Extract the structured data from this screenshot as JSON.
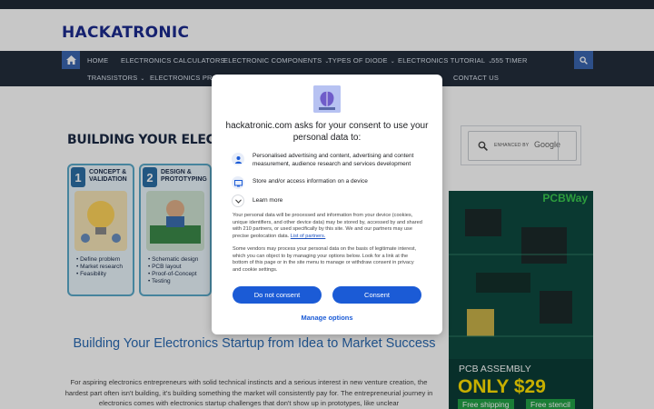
{
  "site": {
    "brand": "HACKATRONIC"
  },
  "nav": {
    "row1": [
      {
        "label": "HOME",
        "dropdown": false
      },
      {
        "label": "ELECTRONICS CALCULATORS",
        "dropdown": false
      },
      {
        "label": "ELECTRONIC COMPONENTS",
        "dropdown": true
      },
      {
        "label": "TYPES OF DIODE",
        "dropdown": true
      },
      {
        "label": "ELECTRONICS TUTORIAL",
        "dropdown": true
      },
      {
        "label": "555 TIMER",
        "dropdown": false
      }
    ],
    "row2": [
      {
        "label": "TRANSISTORS",
        "dropdown": true
      },
      {
        "label": "ELECTRONICS PROJ",
        "dropdown": false
      },
      {
        "label": "CONTACT US",
        "dropdown": false
      }
    ],
    "chevron": "⌄"
  },
  "hero": {
    "title": "BUILDING YOUR ELECTRONICS",
    "steps": [
      {
        "num": "1",
        "head": [
          "CONCEPT &",
          "VALIDATION"
        ],
        "items": [
          "• Define problem",
          "• Market research",
          "• Feasibility"
        ]
      },
      {
        "num": "2",
        "head": [
          "DESIGN &",
          "PROTOTYPING"
        ],
        "items": [
          "• Schematic design",
          "• PCB layout",
          "• Proof-of-Concept",
          "• Testing"
        ]
      }
    ]
  },
  "search_widget": {
    "enhanced_by": "ENHANCED BY",
    "google": "Google"
  },
  "ad": {
    "brand": "PCBWay",
    "line1": "PCB ASSEMBLY",
    "line2": "ONLY $29",
    "badge1": "Free shipping",
    "badge2": "Free stencil"
  },
  "post": {
    "title": "Building Your Electronics Startup from Idea to Market Success",
    "body": "For aspiring electronics entrepreneurs with solid technical instincts and a serious interest in new venture creation, the hardest part often isn't building, it's building something the market will consistently pay for. The entrepreneurial journey in electronics comes with electronics startup challenges that don't show up in prototypes, like unclear"
  },
  "consent": {
    "title": "hackatronic.com asks for your consent to use your personal data to:",
    "purposes": [
      {
        "icon": "person-icon",
        "text": "Personalised advertising and content, advertising and content measurement, audience research and services development"
      },
      {
        "icon": "device-icon",
        "text": "Store and/or access information on a device"
      }
    ],
    "learn_more": "Learn more",
    "para1": "Your personal data will be processed and information from your device (cookies, unique identifiers, and other device data) may be stored by, accessed by and shared with 210 partners, or used specifically by this site. We and our partners may use precise geolocation data.",
    "partners_link": "List of partners.",
    "para2": "Some vendors may process your personal data on the basis of legitimate interest, which you can object to by managing your options below. Look for a link at the bottom of this page or in the site menu to manage or withdraw consent in privacy and cookie settings.",
    "do_not_consent": "Do not consent",
    "consent": "Consent",
    "manage": "Manage options"
  },
  "colors": {
    "navbar": "#232d3b",
    "brand": "#1c2b8f",
    "accent": "#3a66b0",
    "consent_button": "#1b5bd6",
    "ad_green": "#22a046",
    "ad_yellow": "#ffe100"
  }
}
